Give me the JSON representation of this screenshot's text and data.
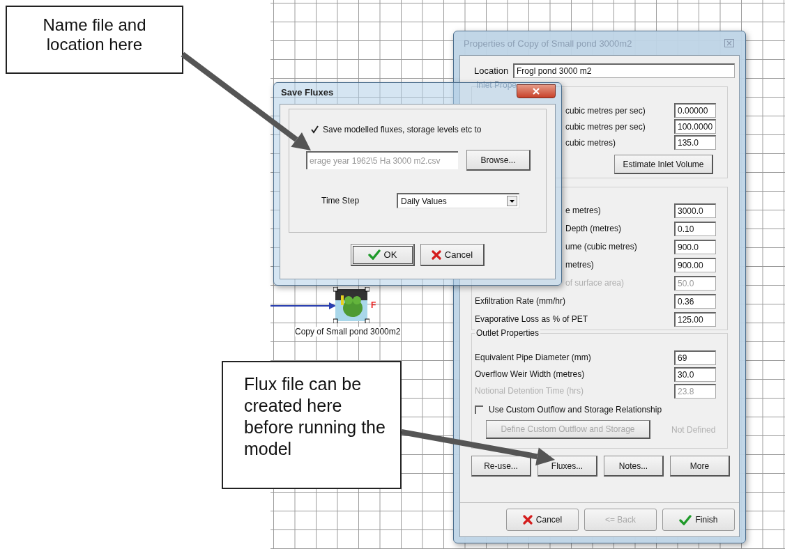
{
  "callouts": [
    {
      "text": "Name file and location here"
    },
    {
      "text": "Flux file can be created here before running the model"
    }
  ],
  "diagram": {
    "node_label": "Copy of Small pond 3000m2",
    "node_marker": "F"
  },
  "properties_dialog": {
    "title": "Properties of Copy of Small pond 3000m2",
    "location": {
      "label": "Location",
      "value": "Frogl pond 3000 m2"
    },
    "inlet_group": {
      "legend": "Inlet Prope",
      "rows": [
        {
          "label": "cubic metres per sec)",
          "value": "0.00000",
          "covered": true,
          "disabled": false
        },
        {
          "label": "cubic metres per sec)",
          "value": "100.0000",
          "covered": true,
          "disabled": false
        },
        {
          "label": "cubic metres)",
          "value": "135.0",
          "covered": true,
          "disabled": false
        }
      ],
      "button": "Estimate Inlet Volume"
    },
    "storage_group": {
      "rows": [
        {
          "label": "e metres)",
          "value": "3000.0",
          "covered": true,
          "disabled": false
        },
        {
          "label": "Depth (metres)",
          "value": "0.10",
          "covered": true,
          "disabled": false
        },
        {
          "label": "ume (cubic metres)",
          "value": "900.0",
          "covered": true,
          "disabled": false
        },
        {
          "label": "metres)",
          "value": "900.00",
          "covered": true,
          "disabled": false
        },
        {
          "label": "of surface area)",
          "value": "50.0",
          "covered": true,
          "disabled": true
        },
        {
          "label": "Exfiltration Rate (mm/hr)",
          "value": "0.36",
          "disabled": false
        },
        {
          "label": "Evaporative Loss as % of PET",
          "value": "125.00",
          "disabled": false
        }
      ]
    },
    "outlet_group": {
      "legend": "Outlet Properties",
      "rows": [
        {
          "label": "Equivalent Pipe Diameter (mm)",
          "value": "69",
          "disabled": false
        },
        {
          "label": "Overflow Weir Width (metres)",
          "value": "30.0",
          "disabled": false
        },
        {
          "label": "Notional Detention Time (hrs)",
          "value": "23.8",
          "disabled": true
        }
      ],
      "checkbox": {
        "label": "Use Custom Outflow and Storage Relationship",
        "checked": false
      },
      "define_button": {
        "label": "Define Custom Outflow and Storage",
        "disabled": true
      },
      "status": {
        "text": "Not Defined",
        "disabled": true
      }
    },
    "action_buttons": [
      "Re-use...",
      "Fluxes...",
      "Notes...",
      "More"
    ],
    "footer_buttons": [
      {
        "label": "Cancel",
        "kind": "cancel",
        "disabled": false
      },
      {
        "label": "<= Back",
        "kind": "back",
        "disabled": true
      },
      {
        "label": "Finish",
        "kind": "finish",
        "disabled": false
      }
    ]
  },
  "save_fluxes_dialog": {
    "title": "Save Fluxes",
    "checkbox": {
      "label": "Save modelled fluxes, storage levels etc to",
      "checked": true
    },
    "path": {
      "value": "erage year 1962\\5 Ha 3000 m2.csv",
      "disabled": true
    },
    "browse": "Browse...",
    "time_step": {
      "label": "Time Step",
      "value": "Daily Values"
    },
    "buttons": [
      {
        "label": "OK",
        "kind": "ok"
      },
      {
        "label": "Cancel",
        "kind": "cancel"
      }
    ]
  }
}
